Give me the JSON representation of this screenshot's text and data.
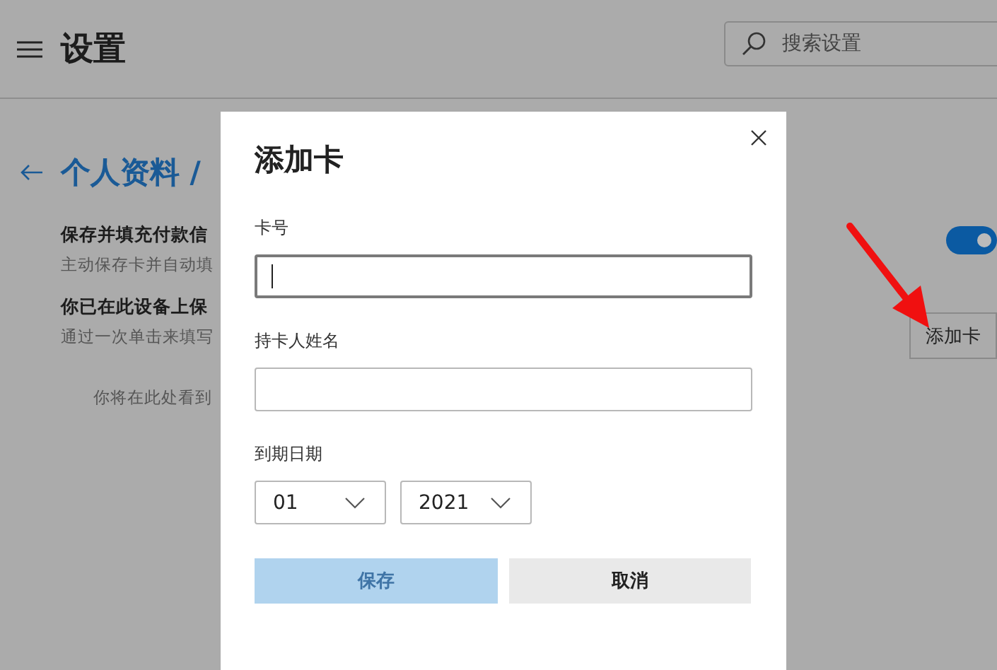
{
  "header": {
    "title": "设置",
    "search": {
      "placeholder": "搜索设置"
    }
  },
  "breadcrumb": "个人资料 /",
  "settings": [
    {
      "title": "保存并填充付款信",
      "description": "主动保存卡并自动填",
      "kind": "toggle",
      "on": true
    },
    {
      "title": "你已在此设备上保",
      "description": "通过一次单击来填写",
      "kind": "button",
      "button": "添加卡"
    }
  ],
  "empty_message": "你将在此处看到",
  "dialog": {
    "title": "添加卡",
    "fields": [
      {
        "label": "卡号",
        "focused": true
      },
      {
        "label": "持卡人姓名",
        "focused": false
      }
    ],
    "expiry": {
      "label": "到期日期",
      "month": "01",
      "year": "2021"
    },
    "buttons": [
      {
        "label": "保存",
        "kind": "primary",
        "disabled": true
      },
      {
        "label": "取消",
        "kind": "secondary",
        "disabled": false
      }
    ]
  }
}
